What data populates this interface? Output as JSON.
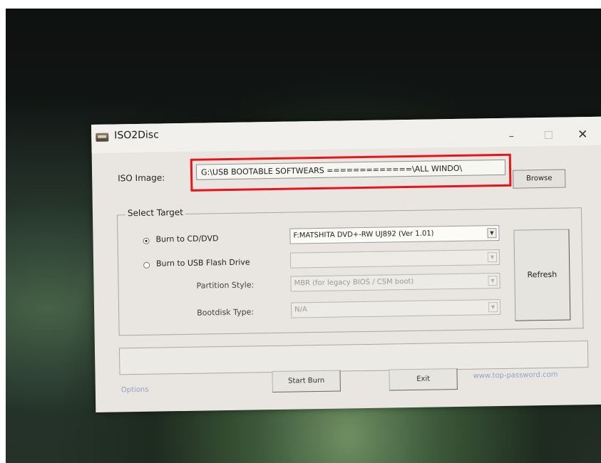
{
  "window": {
    "title": "ISO2Disc"
  },
  "titlebar": {
    "minimize": "–",
    "maximize": "☐",
    "close": "✕"
  },
  "iso": {
    "label": "ISO Image:",
    "path": "G:\\USB BOOTABLE   SOFTWEARS =============\\ALL WINDO\\",
    "browse_label": "Browse"
  },
  "target": {
    "group_label": "Select Target",
    "burn_cd_label": "Burn to CD/DVD",
    "burn_cd_selected": true,
    "cd_drive": "F:MATSHITA DVD+-RW UJ892 (Ver 1.01)",
    "burn_usb_label": "Burn to USB Flash Drive",
    "usb_drive": "",
    "partition_style_label": "Partition Style:",
    "partition_style_value": "MBR (for legacy BIOS / CSM boot)",
    "bootdisk_type_label": "Bootdisk Type:",
    "bootdisk_type_value": "N/A",
    "refresh_label": "Refresh"
  },
  "footer": {
    "options_label": "Options",
    "start_burn_label": "Start Burn",
    "exit_label": "Exit",
    "website": "www.top-password.com"
  },
  "colors": {
    "highlight_border": "#e8141a",
    "link": "#8aa6c5"
  }
}
